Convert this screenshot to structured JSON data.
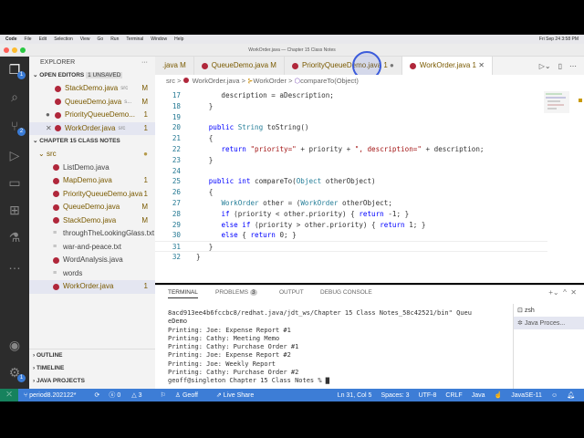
{
  "menubar": {
    "app": "Code",
    "items": [
      "File",
      "Edit",
      "Selection",
      "View",
      "Go",
      "Run",
      "Terminal",
      "Window",
      "Help"
    ],
    "clock": "Fri Sep 24  3:58 PM"
  },
  "window": {
    "title": "WorkOrder.java — Chapter 15 Class Notes"
  },
  "activity": {
    "explorer_badge": "1",
    "scm_badge": "2",
    "accounts_badge": "1"
  },
  "sidebar": {
    "title": "EXPLORER",
    "more": "···",
    "open_editors": {
      "label": "OPEN EDITORS",
      "unsaved": "1 UNSAVED",
      "items": [
        {
          "name": "StackDemo.java",
          "hint": "src",
          "status": "M"
        },
        {
          "name": "QueueDemo.java",
          "hint": "s...",
          "status": "M"
        },
        {
          "name": "PriorityQueueDemo...",
          "hint": "",
          "status": "1"
        },
        {
          "name": "WorkOrder.java",
          "hint": "src",
          "status": "1"
        }
      ]
    },
    "project": {
      "label": "CHAPTER 15 CLASS NOTES",
      "folder": "src",
      "files": [
        {
          "name": "ListDemo.java",
          "status": "",
          "type": "java"
        },
        {
          "name": "MapDemo.java",
          "status": "1",
          "type": "java"
        },
        {
          "name": "PriorityQueueDemo.java",
          "status": "1",
          "type": "java"
        },
        {
          "name": "QueueDemo.java",
          "status": "M",
          "type": "java"
        },
        {
          "name": "StackDemo.java",
          "status": "M",
          "type": "java"
        },
        {
          "name": "throughTheLookingGlass.txt",
          "status": "",
          "type": "text"
        },
        {
          "name": "war-and-peace.txt",
          "status": "",
          "type": "text"
        },
        {
          "name": "WordAnalysis.java",
          "status": "",
          "type": "java"
        },
        {
          "name": "words",
          "status": "",
          "type": "text"
        },
        {
          "name": "WorkOrder.java",
          "status": "1",
          "type": "java"
        }
      ]
    },
    "outline": "OUTLINE",
    "timeline": "TIMELINE",
    "java_projects": "JAVA PROJECTS"
  },
  "tabs": [
    {
      "label": ".java M"
    },
    {
      "label": "QueueDemo.java M"
    },
    {
      "label": "PriorityQueueDemo.java 1"
    },
    {
      "label": "WorkOrder.java 1"
    }
  ],
  "breadcrumb": [
    "src",
    ">",
    "WorkOrder.java",
    ">",
    "WorkOrder",
    ">",
    "compareTo(Object)"
  ],
  "code": [
    {
      "n": "17",
      "t": [
        [
          "",
          "      description = aDescription;"
        ]
      ]
    },
    {
      "n": "18",
      "t": [
        [
          "",
          "   }"
        ]
      ]
    },
    {
      "n": "19",
      "t": [
        [
          "",
          ""
        ]
      ]
    },
    {
      "n": "20",
      "t": [
        [
          "",
          "   "
        ],
        [
          "kw",
          "public"
        ],
        [
          "",
          " "
        ],
        [
          "tp",
          "String"
        ],
        [
          "",
          " toString()"
        ]
      ]
    },
    {
      "n": "21",
      "t": [
        [
          "",
          "   {"
        ]
      ]
    },
    {
      "n": "22",
      "t": [
        [
          "",
          "      "
        ],
        [
          "kw",
          "return"
        ],
        [
          "",
          " "
        ],
        [
          "str",
          "\"priority=\""
        ],
        [
          "",
          " + priority + "
        ],
        [
          "str",
          "\", description=\""
        ],
        [
          "",
          " + description;"
        ]
      ]
    },
    {
      "n": "23",
      "t": [
        [
          "",
          "   }"
        ]
      ]
    },
    {
      "n": "24",
      "t": [
        [
          "",
          ""
        ]
      ]
    },
    {
      "n": "25",
      "t": [
        [
          "",
          "   "
        ],
        [
          "kw",
          "public int"
        ],
        [
          "",
          " compareTo("
        ],
        [
          "tp",
          "Object"
        ],
        [
          "",
          " otherObject)"
        ]
      ]
    },
    {
      "n": "26",
      "t": [
        [
          "",
          "   {"
        ]
      ]
    },
    {
      "n": "27",
      "t": [
        [
          "",
          "      "
        ],
        [
          "tp",
          "WorkOrder"
        ],
        [
          "",
          " other = ("
        ],
        [
          "tp",
          "WorkOrder"
        ],
        [
          "",
          " otherObject;"
        ]
      ]
    },
    {
      "n": "28",
      "t": [
        [
          "",
          "      "
        ],
        [
          "kw",
          "if"
        ],
        [
          "",
          " (priority < other.priority) { "
        ],
        [
          "kw",
          "return"
        ],
        [
          "",
          " -1; }"
        ]
      ]
    },
    {
      "n": "29",
      "t": [
        [
          "",
          "      "
        ],
        [
          "kw",
          "else if"
        ],
        [
          "",
          " (priority > other.priority) { "
        ],
        [
          "kw",
          "return"
        ],
        [
          "",
          " 1; }"
        ]
      ]
    },
    {
      "n": "30",
      "t": [
        [
          "",
          "      "
        ],
        [
          "kw",
          "else"
        ],
        [
          "",
          " { "
        ],
        [
          "kw",
          "return"
        ],
        [
          "",
          " 0; }"
        ]
      ]
    },
    {
      "n": "31",
      "t": [
        [
          "",
          "   }"
        ]
      ]
    },
    {
      "n": "32",
      "t": [
        [
          "",
          "}"
        ]
      ]
    }
  ],
  "panel": {
    "tabs": [
      "TERMINAL",
      "PROBLEMS",
      "OUTPUT",
      "DEBUG CONSOLE"
    ],
    "problems_count": "3",
    "terminal": [
      "8acd913ee4b6fccbc8/redhat.java/jdt_ws/Chapter 15 Class Notes_58c42521/bin\" Queu",
      "eDemo",
      "Printing: Joe: Expense Report #1",
      "Printing: Cathy: Meeting Memo",
      "Printing: Cathy: Purchase Order #1",
      "Printing: Joe: Expense Report #2",
      "Printing: Joe: Weekly Report",
      "Printing: Cathy: Purchase Order #2",
      "geoff@singleton Chapter 15 Class Notes % ▇"
    ],
    "terminals": [
      "zsh",
      "Java Proces..."
    ]
  },
  "status": {
    "branch": "period8.202122*",
    "errors": "0",
    "warnings": "3",
    "user": "Geoff",
    "liveshare": "Live Share",
    "position": "Ln 31, Col 5",
    "spaces": "Spaces: 3",
    "encoding": "UTF-8",
    "eol": "CRLF",
    "language": "Java",
    "runtime": "JavaSE-11"
  },
  "colors": {
    "status_bar": "#3d7dd6",
    "remote": "#16825d",
    "java_icon": "#b0273b",
    "modified": "#7a5a00"
  }
}
